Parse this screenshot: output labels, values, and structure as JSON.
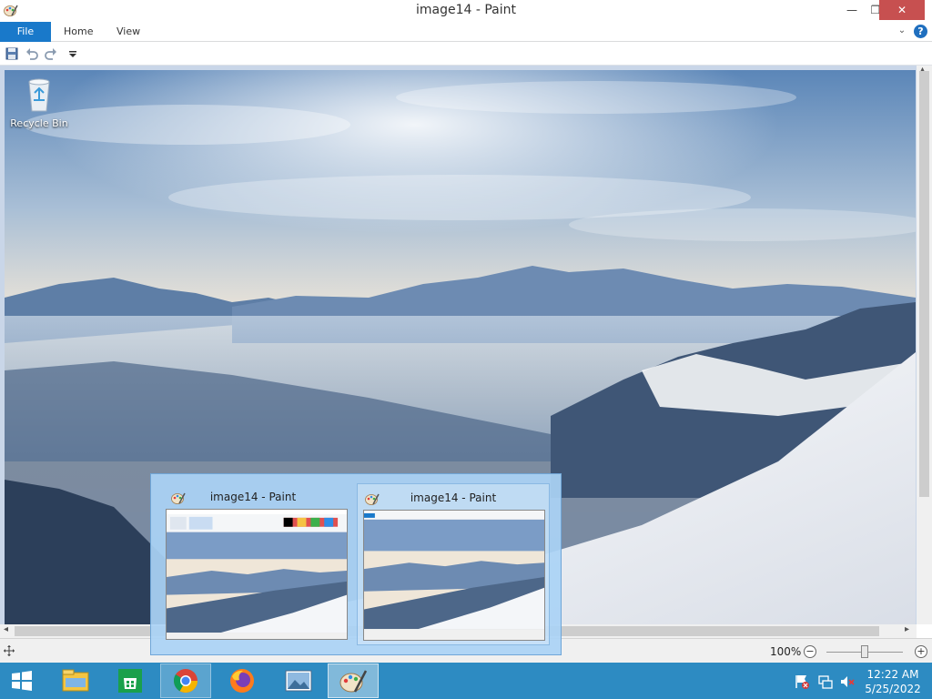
{
  "window": {
    "title": "image14 - Paint",
    "controls": {
      "minimize": "—",
      "restore": "❐",
      "close": "✕"
    }
  },
  "ribbon": {
    "tabs": [
      "File",
      "Home",
      "View"
    ],
    "collapse_glyph": "⌄",
    "help_glyph": "?"
  },
  "quick_access": {
    "buttons": [
      "save-icon",
      "undo-icon",
      "redo-icon",
      "customize-icon"
    ]
  },
  "desktop": {
    "icon_label": "Recycle Bin"
  },
  "statusbar": {
    "zoom_text": "100%",
    "zoom_out": "−",
    "zoom_in": "+",
    "zoom_level": 1.0
  },
  "taskbar": {
    "items": [
      "start-button",
      "file-explorer",
      "store",
      "chrome",
      "firefox",
      "photos",
      "paint"
    ],
    "clock_time": "12:22 AM",
    "clock_date": "5/25/2022"
  },
  "preview": {
    "cards": [
      {
        "title": "image14 - Paint"
      },
      {
        "title": "image14 - Paint"
      }
    ]
  },
  "colors": {
    "file_tab": "#1979ca",
    "taskbar": "#2d8bc2",
    "close_button": "#c75050",
    "canvas_bg": "#c9d6e8"
  }
}
